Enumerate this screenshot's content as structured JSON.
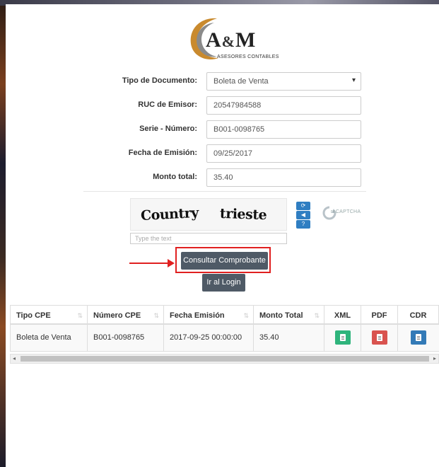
{
  "logo": {
    "name": "A&M",
    "name_left": "A",
    "name_amp": "&",
    "name_right": "M",
    "subtitle": "ASESORES CONTABLES"
  },
  "form": {
    "tipo_documento": {
      "label": "Tipo de Documento:",
      "value": "Boleta de Venta"
    },
    "ruc_emisor": {
      "label": "RUC de Emisor:",
      "value": "20547984588"
    },
    "serie_numero": {
      "label": "Serie - Número:",
      "value": "B001-0098765"
    },
    "fecha_emision": {
      "label": "Fecha de Emisión:",
      "value": "09/25/2017"
    },
    "monto_total": {
      "label": "Monto total:",
      "value": "35.40"
    }
  },
  "captcha": {
    "word1": "Country",
    "word2": "trieste",
    "input_placeholder": "Type the text",
    "provider_label": "reCAPTCHA"
  },
  "buttons": {
    "consultar": "Consultar Comprobante",
    "login": "Ir al Login"
  },
  "table": {
    "headers": {
      "tipo_cpe": "Tipo CPE",
      "numero_cpe": "Número CPE",
      "fecha_emision": "Fecha Emisión",
      "monto_total": "Monto Total",
      "xml": "XML",
      "pdf": "PDF",
      "cdr": "CDR"
    },
    "rows": [
      {
        "tipo_cpe": "Boleta de Venta",
        "numero_cpe": "B001-0098765",
        "fecha_emision": "2017-09-25 00:00:00",
        "monto_total": "35.40"
      }
    ]
  },
  "colors": {
    "accent_red": "#e02020",
    "button_dark": "#4f5a66",
    "xml_green": "#2fb47c",
    "pdf_red": "#d9534f",
    "cdr_blue": "#337ab7"
  },
  "icons": {
    "refresh": "refresh-icon",
    "audio": "audio-icon",
    "help": "help-icon",
    "sort": "sort-icon",
    "xml_file": "file-excel-icon",
    "pdf_file": "file-pdf-icon",
    "cdr_file": "file-text-icon"
  }
}
